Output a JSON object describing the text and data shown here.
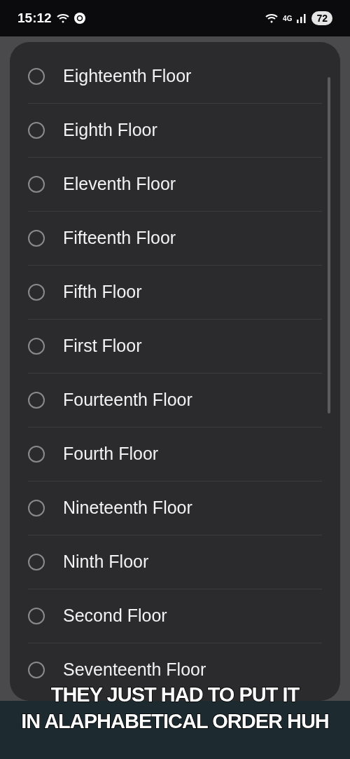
{
  "status_bar": {
    "time": "15:12",
    "network": "4G",
    "battery": "72"
  },
  "dialog": {
    "options": [
      {
        "label": "Eighteenth Floor",
        "selected": false
      },
      {
        "label": "Eighth Floor",
        "selected": false
      },
      {
        "label": "Eleventh Floor",
        "selected": false
      },
      {
        "label": "Fifteenth Floor",
        "selected": false
      },
      {
        "label": "Fifth Floor",
        "selected": false
      },
      {
        "label": "First Floor",
        "selected": false
      },
      {
        "label": "Fourteenth Floor",
        "selected": false
      },
      {
        "label": "Fourth Floor",
        "selected": false
      },
      {
        "label": "Nineteenth Floor",
        "selected": false
      },
      {
        "label": "Ninth Floor",
        "selected": false
      },
      {
        "label": "Second Floor",
        "selected": false
      },
      {
        "label": "Seventeenth Floor",
        "selected": false
      }
    ]
  },
  "caption": {
    "lines": [
      "THEY JUST HAD TO PUT IT",
      "IN ALAPHABETICAL ORDER HUH"
    ]
  }
}
